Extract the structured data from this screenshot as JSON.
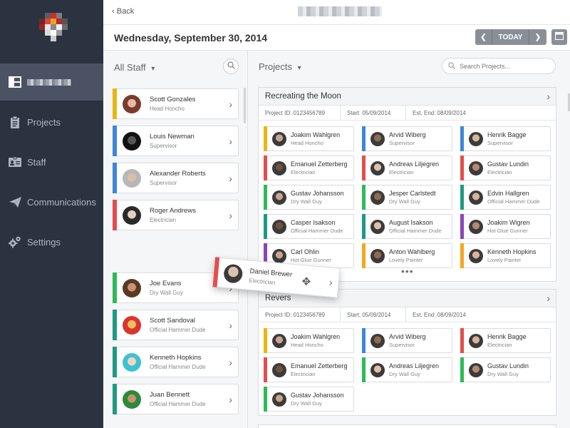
{
  "colors": {
    "yellow": "#e9b612",
    "blue": "#3f86d6",
    "red": "#e54d4d",
    "green": "#2dbb57",
    "teal": "#1d9a84",
    "purple": "#8a46b8",
    "orange": "#f5a623",
    "sidebar_bg": "#2c3340"
  },
  "sidebar": {
    "items": [
      {
        "label": "",
        "icon": "dashboard-icon",
        "blurred": true
      },
      {
        "label": "Projects",
        "icon": "clipboard-icon"
      },
      {
        "label": "Staff",
        "icon": "id-card-icon"
      },
      {
        "label": "Communications",
        "icon": "paper-plane-icon"
      },
      {
        "label": "Settings",
        "icon": "gears-icon"
      }
    ]
  },
  "topbar": {
    "back_label": "Back"
  },
  "datebar": {
    "date": "Wednesday, September 30, 2014",
    "today_label": "TODAY"
  },
  "staff": {
    "header": "All Staff",
    "list": [
      {
        "name": "Scott Gonzales",
        "role": "Head Honcho",
        "color": "#e9b612"
      },
      {
        "name": "Louis Newman",
        "role": "Supervisor",
        "color": "#3f86d6"
      },
      {
        "name": "Alexander Roberts",
        "role": "Supervisor",
        "color": "#3f86d6"
      },
      {
        "name": "Roger Andrews",
        "role": "Electrician",
        "color": "#e54d4d"
      },
      {
        "name": "Joe Evans",
        "role": "Dry Wall Guy",
        "color": "#2dbb57"
      },
      {
        "name": "Scott Sandoval",
        "role": "Official Hammer Dude",
        "color": "#1d9a84"
      },
      {
        "name": "Kenneth Hopkins",
        "role": "Official Hammer Dude",
        "color": "#1d9a84"
      },
      {
        "name": "Juan Bennett",
        "role": "Official Hammer Dude",
        "color": "#1d9a84"
      }
    ]
  },
  "dragging": {
    "name": "Daniel Brewer",
    "role": "Electrician"
  },
  "projects": {
    "header": "Projects",
    "search_placeholder": "Search Projects...",
    "panels": [
      {
        "title": "Recreating the Moon",
        "project_id": "Project ID: 0123456789",
        "start": "Start: 05/09/2014",
        "end": "Est. End: 08/09/2014",
        "more": "•••",
        "members": [
          {
            "name": "Joakim Wahlgren",
            "role": "Head Honcho",
            "color": "#e9b612"
          },
          {
            "name": "Arvid Wiberg",
            "role": "Supervisor",
            "color": "#3f86d6"
          },
          {
            "name": "Henrik Bagge",
            "role": "Supervisor",
            "color": "#3f86d6"
          },
          {
            "name": "Emanuel Zetterberg",
            "role": "Electrician",
            "color": "#e54d4d"
          },
          {
            "name": "Andreas Liljegren",
            "role": "Electrician",
            "color": "#e54d4d"
          },
          {
            "name": "Gustav Lundin",
            "role": "Electrician",
            "color": "#e54d4d"
          },
          {
            "name": "Gustav Johansson",
            "role": "Dry Wall Guy",
            "color": "#2dbb57"
          },
          {
            "name": "Jesper Carlstedt",
            "role": "Dry Wall Guy",
            "color": "#2dbb57"
          },
          {
            "name": "Edvin Hallgren",
            "role": "Official Hammer Dude",
            "color": "#1d9a84"
          },
          {
            "name": "Casper Isakson",
            "role": "Official Hammer Dude",
            "color": "#1d9a84"
          },
          {
            "name": "August Isakson",
            "role": "Official Hammer Dude",
            "color": "#1d9a84"
          },
          {
            "name": "Joakim Wigren",
            "role": "Hot Glue Gunner",
            "color": "#8a46b8"
          },
          {
            "name": "Carl Ohlin",
            "role": "Hot Glue Gunner",
            "color": "#8a46b8"
          },
          {
            "name": "Anton Wahlberg",
            "role": "Lovely Painter",
            "color": "#f5a623"
          },
          {
            "name": "Kenneth Hopkins",
            "role": "Lovely Painter",
            "color": "#f5a623"
          }
        ]
      },
      {
        "title": "Revers",
        "project_id": "Project ID: 0123456789",
        "start": "Start: 05/09/2014",
        "end": "Est. End: 08/09/2014",
        "members": [
          {
            "name": "Joakim Wahlgren",
            "role": "Head Honcho",
            "color": "#e9b612"
          },
          {
            "name": "Arvid Wiberg",
            "role": "Supervisor",
            "color": "#3f86d6"
          },
          {
            "name": "Henrik Bagge",
            "role": "Electrician",
            "color": "#e54d4d"
          },
          {
            "name": "Emanuel Zetterberg",
            "role": "Electrician",
            "color": "#e54d4d"
          },
          {
            "name": "Andreas Liljegren",
            "role": "Dry Wall Guy",
            "color": "#2dbb57"
          },
          {
            "name": "Gustav Lundin",
            "role": "Dry Wall Guy",
            "color": "#2dbb57"
          },
          {
            "name": "Gustav Johansson",
            "role": "Dry Wall Guy",
            "color": "#2dbb57"
          }
        ]
      }
    ]
  }
}
